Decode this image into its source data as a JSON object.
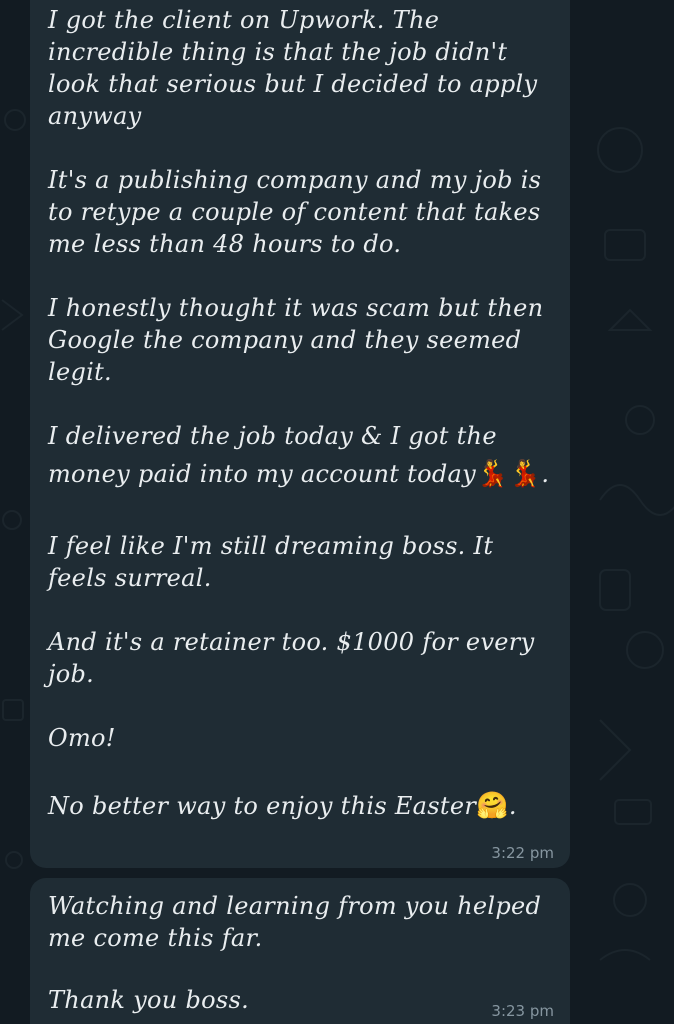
{
  "messages": [
    {
      "lines": [
        "I got the client on Upwork. The",
        "incredible thing is that the job didn't",
        "look that serious but I decided to apply",
        "anyway",
        "It's a publishing company and my job is",
        "to retype a couple of content that takes",
        "me less than 48 hours to do.",
        "I honestly thought it was scam but then",
        "Google the company and they seemed",
        "legit.",
        "I delivered the job today & I got the",
        "money paid into my account today",
        "I feel like I'm still dreaming boss. It",
        "feels surreal.",
        "And it's a retainer too. $1000 for every",
        "job.",
        "Omo!",
        "No better way to enjoy this Easter"
      ],
      "emojis": {
        "dancers": "💃💃",
        "dancers_suffix": ".",
        "hug": "🤗",
        "hug_suffix": "."
      },
      "time": "3:22 pm"
    },
    {
      "lines": [
        "Watching and learning from you helped",
        "me come this far.",
        "Thank you boss."
      ],
      "time": "3:23 pm"
    }
  ],
  "colors": {
    "background": "#121b22",
    "bubble": "#1f2c34",
    "text": "#e9edef",
    "timestamp": "#8696a0"
  }
}
